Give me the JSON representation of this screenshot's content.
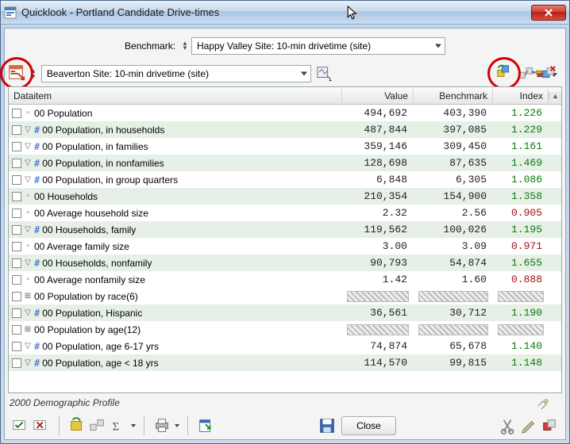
{
  "window": {
    "title": "Quicklook - Portland Candidate Drive-times"
  },
  "benchmark": {
    "label": "Benchmark:",
    "selected": "Happy Valley Site: 10-min drivetime (site)"
  },
  "site": {
    "selected": "Beaverton Site: 10-min drivetime (site)"
  },
  "columns": {
    "name": "Dataitem",
    "value": "Value",
    "benchmark": "Benchmark",
    "index": "Index"
  },
  "rows": [
    {
      "tri": "none",
      "hash": false,
      "name": "00 Population",
      "value": "494,692",
      "benchmark": "403,390",
      "index": "1.226",
      "idxClass": "pos",
      "alt": false
    },
    {
      "tri": "down",
      "hash": true,
      "name": "00 Population, in households",
      "value": "487,844",
      "benchmark": "397,085",
      "index": "1.229",
      "idxClass": "pos",
      "alt": true
    },
    {
      "tri": "down",
      "hash": true,
      "name": "00 Population, in families",
      "value": "359,146",
      "benchmark": "309,450",
      "index": "1.161",
      "idxClass": "pos",
      "alt": false
    },
    {
      "tri": "down",
      "hash": true,
      "name": "00 Population, in nonfamilies",
      "value": "128,698",
      "benchmark": "87,635",
      "index": "1.469",
      "idxClass": "pos",
      "alt": true
    },
    {
      "tri": "down",
      "hash": true,
      "name": "00 Population, in group quarters",
      "value": "6,848",
      "benchmark": "6,305",
      "index": "1.086",
      "idxClass": "pos",
      "alt": false
    },
    {
      "tri": "none",
      "hash": false,
      "name": "00 Households",
      "value": "210,354",
      "benchmark": "154,900",
      "index": "1.358",
      "idxClass": "pos",
      "alt": true
    },
    {
      "tri": "none",
      "hash": false,
      "name": "00 Average household size",
      "value": "2.32",
      "benchmark": "2.56",
      "index": "0.905",
      "idxClass": "neg",
      "alt": false
    },
    {
      "tri": "down",
      "hash": true,
      "name": "00 Households, family",
      "value": "119,562",
      "benchmark": "100,026",
      "index": "1.195",
      "idxClass": "pos",
      "alt": true
    },
    {
      "tri": "none",
      "hash": false,
      "name": "00 Average family size",
      "value": "3.00",
      "benchmark": "3.09",
      "index": "0.971",
      "idxClass": "neg",
      "alt": false
    },
    {
      "tri": "down",
      "hash": true,
      "name": "00 Households, nonfamily",
      "value": "90,793",
      "benchmark": "54,874",
      "index": "1.655",
      "idxClass": "pos",
      "alt": true
    },
    {
      "tri": "none",
      "hash": false,
      "name": "00 Average nonfamily size",
      "value": "1.42",
      "benchmark": "1.60",
      "index": "0.888",
      "idxClass": "neg",
      "alt": false
    },
    {
      "tri": "plus",
      "hash": false,
      "name": "00 Population by race(6)",
      "value": "",
      "benchmark": "",
      "index": "",
      "idxClass": "hatch",
      "alt": false
    },
    {
      "tri": "down",
      "hash": true,
      "name": "00 Population, Hispanic",
      "value": "36,561",
      "benchmark": "30,712",
      "index": "1.190",
      "idxClass": "pos",
      "alt": true
    },
    {
      "tri": "plus",
      "hash": false,
      "name": "00 Population by age(12)",
      "value": "",
      "benchmark": "",
      "index": "",
      "idxClass": "hatch",
      "alt": false
    },
    {
      "tri": "down",
      "hash": true,
      "name": "00 Population, age 6-17 yrs",
      "value": "74,874",
      "benchmark": "65,678",
      "index": "1.140",
      "idxClass": "pos",
      "alt": false
    },
    {
      "tri": "down",
      "hash": true,
      "name": "00 Population, age < 18 yrs",
      "value": "114,570",
      "benchmark": "99,815",
      "index": "1.148",
      "idxClass": "pos",
      "alt": true
    }
  ],
  "footer": {
    "profile": "2000 Demographic Profile",
    "close": "Close"
  }
}
